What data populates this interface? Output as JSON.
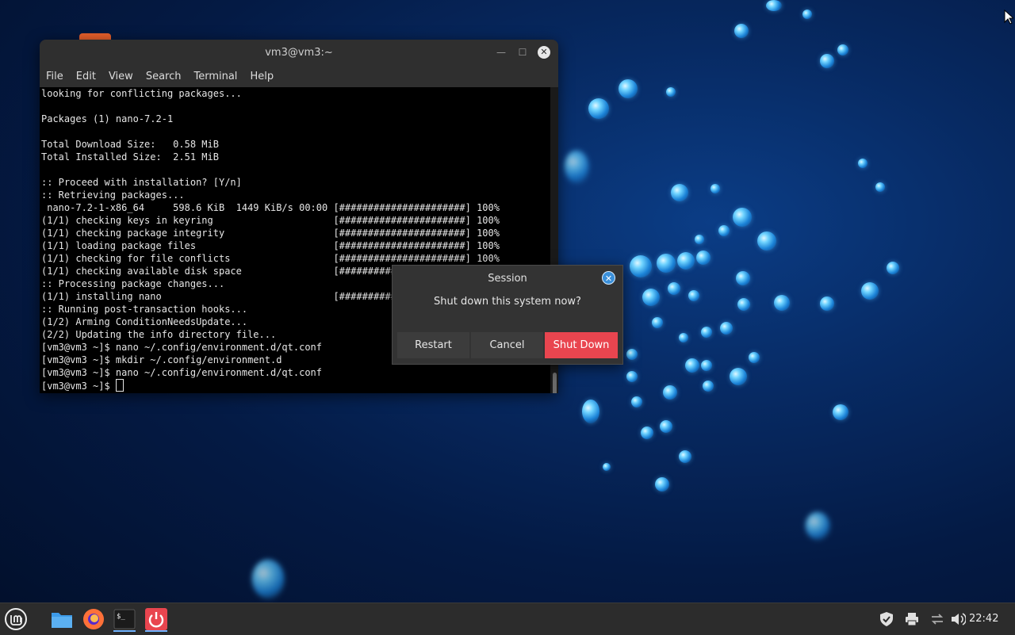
{
  "terminal": {
    "title": "vm3@vm3:~",
    "menu": [
      "File",
      "Edit",
      "View",
      "Search",
      "Terminal",
      "Help"
    ],
    "lines": [
      "looking for conflicting packages...",
      "",
      "Packages (1) nano-7.2-1",
      "",
      "Total Download Size:   0.58 MiB",
      "Total Installed Size:  2.51 MiB",
      "",
      ":: Proceed with installation? [Y/n]",
      ":: Retrieving packages...",
      " nano-7.2-1-x86_64     598.6 KiB  1449 KiB/s 00:00 [######################] 100%",
      "(1/1) checking keys in keyring                     [######################] 100%",
      "(1/1) checking package integrity                   [######################] 100%",
      "(1/1) loading package files                        [######################] 100%",
      "(1/1) checking for file conflicts                  [######################] 100%",
      "(1/1) checking available disk space                [######################] 100%",
      ":: Processing package changes...",
      "(1/1) installing nano                              [######################] 100%",
      ":: Running post-transaction hooks...",
      "(1/2) Arming ConditionNeedsUpdate...",
      "(2/2) Updating the info directory file...",
      "[vm3@vm3 ~]$ nano ~/.config/environment.d/qt.conf",
      "[vm3@vm3 ~]$ mkdir ~/.config/environment.d",
      "[vm3@vm3 ~]$ nano ~/.config/environment.d/qt.conf"
    ],
    "prompt": "[vm3@vm3 ~]$ "
  },
  "dialog": {
    "title": "Session",
    "message": "Shut down this system now?",
    "restart_label": "Restart",
    "cancel_label": "Cancel",
    "shutdown_label": "Shut Down",
    "shutdown_color": "#e9454f"
  },
  "panel": {
    "launchers": [
      "menu-icon",
      "files-icon",
      "firefox-icon",
      "terminal-icon",
      "power-icon"
    ],
    "tray": [
      "shield-icon",
      "printer-icon",
      "network-icon",
      "volume-icon"
    ],
    "clock": "22:42"
  }
}
